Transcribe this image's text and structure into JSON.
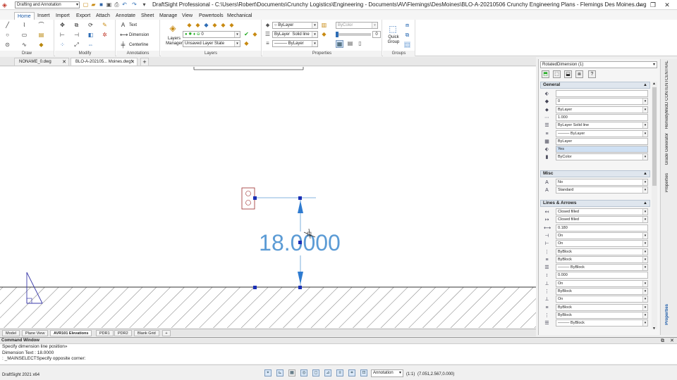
{
  "app": {
    "workspace": "Drafting and Annotation",
    "title": "DraftSight Professional - C:\\Users\\Robert\\Documents\\Crunchy Logistics\\Engineering - Documents\\AV\\Flemings\\DesMoines\\BLO-A-20210506 Crunchy Engineering Plans - Flemings Des Moines.dwg",
    "version": "DraftSight 2021 x64"
  },
  "ribbon_tabs": [
    "Home",
    "Insert",
    "Import",
    "Export",
    "Attach",
    "Annotate",
    "Sheet",
    "Manage",
    "View",
    "Powertools",
    "Mechanical"
  ],
  "ribbon": {
    "groups": {
      "draw": "Draw",
      "modify": "Modify",
      "annotations": "Annotations",
      "layers": "Layers",
      "properties": "Properties",
      "groups": "Groups"
    },
    "annotations": {
      "text": "Text",
      "dimension": "Dimension",
      "centerline": "Centerline"
    },
    "layers": {
      "manager": "Layers Manager",
      "layer_value": "0",
      "layer_state": "Unsaved Layer State"
    },
    "properties": {
      "color": "ByLayer",
      "linestyle_layer": "ByLayer",
      "linestyle_name": "Solid line",
      "lineweight": "ByLayer",
      "bycolor": "ByColor",
      "transparency": "0"
    },
    "quick_group": "Quick Group"
  },
  "doc_tabs": [
    {
      "label": "NONAME_0.dwg",
      "active": false
    },
    {
      "label": "BLO-A-202105... Moines.dwg*",
      "active": true
    }
  ],
  "drawing": {
    "dimension_text": "18.0000"
  },
  "layout_tabs": [
    {
      "label": "Model",
      "active": false
    },
    {
      "label": "Plane View",
      "active": false
    },
    {
      "label": "AVR101 Elevations",
      "active": true
    },
    {
      "label": "PDR1",
      "active": false
    },
    {
      "label": "PDR2",
      "active": false
    },
    {
      "label": "Blank Grid",
      "active": false
    }
  ],
  "command_window": {
    "title": "Command Window",
    "lines": [
      "Specify dimension line position»",
      "Dimension Text : 18.0000",
      ": _MAINSELECTSpecify opposite corner:"
    ]
  },
  "statusbar": {
    "annotation": "Annotation",
    "scale": "(1:1)",
    "coords": "(7.051,2.567,0.000)"
  },
  "properties": {
    "selection": "RotatedDimension (1)",
    "sections": {
      "general": "General",
      "misc": "Misc",
      "lines_arrows": "Lines & Arrows"
    },
    "general": [
      "",
      "0",
      "ByLayer",
      "1.000",
      "ByLayer    Solid line",
      "——— ByLayer",
      "ByLayer",
      "Yes",
      "ByColor"
    ],
    "misc": [
      "No",
      "Standard"
    ],
    "lines_arrows": [
      "Closed filled",
      "Closed filled",
      "0.180",
      "On",
      "On",
      "ByBlock",
      "ByBlock",
      "——— ByBlock",
      "0.000",
      "On",
      "ByBlock",
      "On",
      "ByBlock",
      "ByBlock",
      "——— ByBlock"
    ]
  },
  "vertical_tabs": [
    "3D CONTENTCENTRAL",
    "HomeByMe",
    "Grade Generator",
    "Properties",
    "Properties"
  ],
  "colors": {
    "accent": "#1a5aa8",
    "dimension": "#5b9bd5",
    "grip": "#1a2fb5"
  }
}
